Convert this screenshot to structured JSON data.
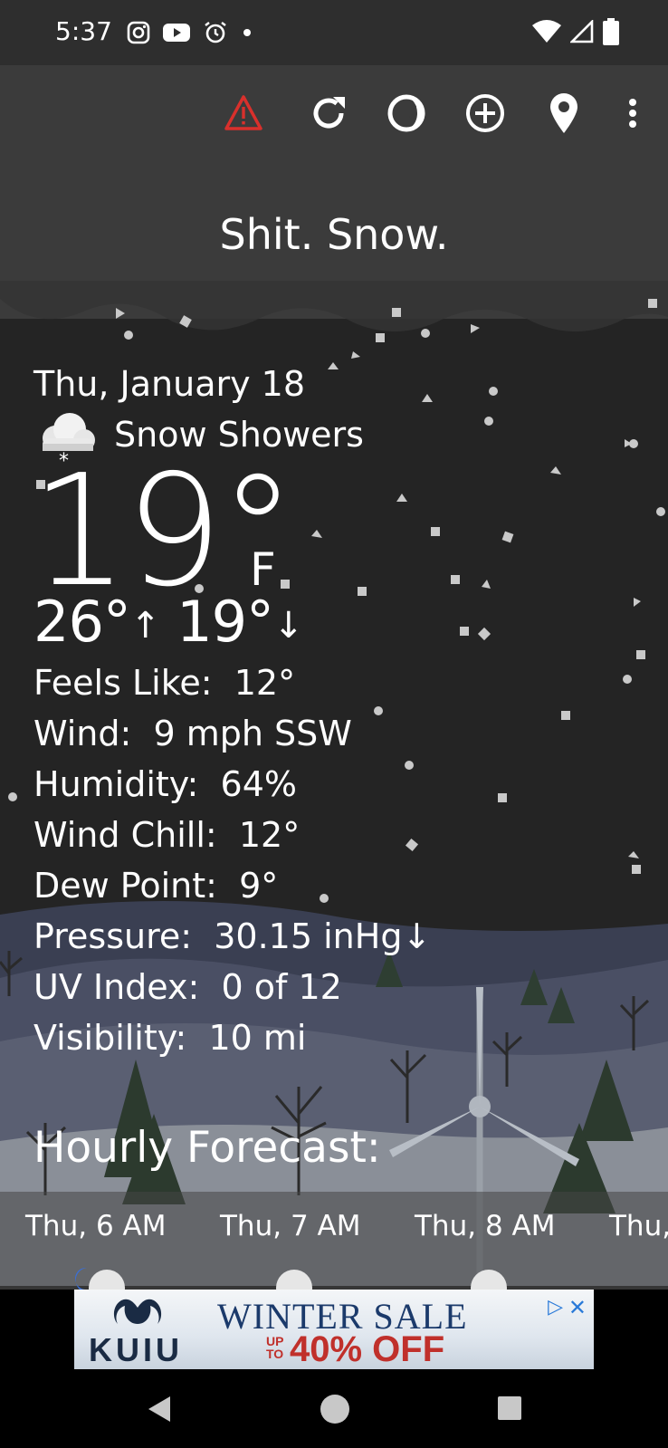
{
  "status_bar": {
    "time": "5:37",
    "left_icons": [
      "instagram-icon",
      "youtube-icon",
      "alarm-icon",
      "dot-icon"
    ],
    "right_icons": [
      "wifi-icon",
      "signal-icon",
      "battery-icon"
    ]
  },
  "toolbar": {
    "buttons": [
      "alert-icon",
      "refresh-icon",
      "theme-icon",
      "add-location-icon",
      "location-pin-icon",
      "overflow-menu-icon"
    ],
    "alert_color": "#d9302c"
  },
  "headline": "Shit. Snow.",
  "current": {
    "date": "Thu, January 18",
    "condition_icon": "snow-cloud-icon",
    "condition": "Snow Showers",
    "temp": "19°",
    "unit": "F",
    "high": "26°",
    "low": "19°"
  },
  "details": [
    {
      "label": "Feels Like:",
      "value": "12°"
    },
    {
      "label": "Wind:",
      "value": "9 mph SSW"
    },
    {
      "label": "Humidity:",
      "value": "64%"
    },
    {
      "label": "Wind Chill:",
      "value": "12°"
    },
    {
      "label": "Dew Point:",
      "value": "9°"
    },
    {
      "label": "Pressure:",
      "value": "30.15 inHg↓"
    },
    {
      "label": "UV Index:",
      "value": "0 of 12"
    },
    {
      "label": "Visibility:",
      "value": "10 mi"
    }
  ],
  "hourly": {
    "title": "Hourly Forecast:",
    "items": [
      "Thu, 6 AM",
      "Thu, 7 AM",
      "Thu, 8 AM",
      "Thu,"
    ]
  },
  "ad": {
    "brand": "KUIU",
    "headline": "WINTER SALE",
    "up_to": "UP TO",
    "offer": "40% OFF",
    "close": "✕",
    "info": "▷"
  },
  "nav": [
    "back-icon",
    "home-icon",
    "recents-icon"
  ]
}
